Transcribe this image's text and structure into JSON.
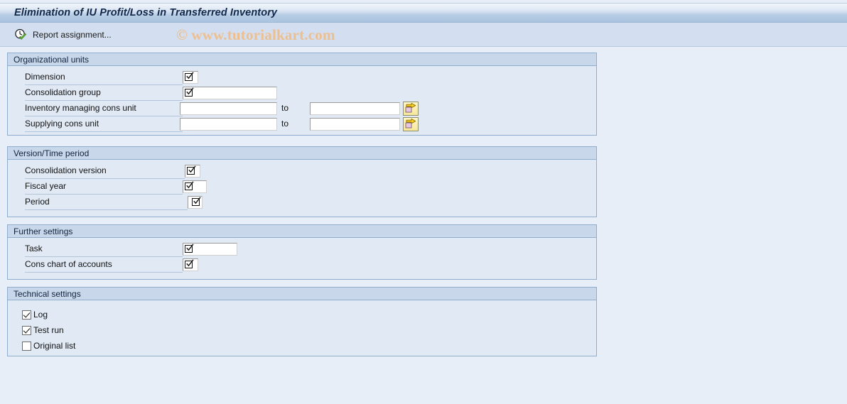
{
  "window": {
    "title": "Elimination of IU Profit/Loss in Transferred Inventory"
  },
  "toolbar": {
    "report_assignment_label": "Report assignment...",
    "report_assignment_icon": "clock-check-icon"
  },
  "watermark": {
    "text": "© www.tutorialkart.com",
    "color": "#edbf8f"
  },
  "colors": {
    "page_background": "#e8eef7",
    "group_background": "#e0e9f4",
    "group_header": "#c8d8ea",
    "group_border": "#8fadcd",
    "titlebar_text": "#11284a",
    "msel_button": "#f6e89a"
  },
  "groups": [
    {
      "title": "Organizational units",
      "fields": [
        {
          "label": "Dimension",
          "value": "",
          "type": "input-glyph"
        },
        {
          "label": "Consolidation group",
          "value": "",
          "type": "input-glyph"
        },
        {
          "label": "Inventory managing cons unit",
          "value": "",
          "to_label": "to",
          "to_value": "",
          "type": "range",
          "msel_icon": "yellow-arrow-icon"
        },
        {
          "label": "Supplying cons unit",
          "value": "",
          "to_label": "to",
          "to_value": "",
          "type": "range",
          "msel_icon": "yellow-arrow-icon"
        }
      ]
    },
    {
      "title": "Version/Time period",
      "fields": [
        {
          "label": "Consolidation version",
          "value": "",
          "type": "input-glyph"
        },
        {
          "label": "Fiscal year",
          "value": "",
          "type": "input-glyph"
        },
        {
          "label": "Period",
          "value": "",
          "type": "input-glyph"
        }
      ]
    },
    {
      "title": "Further settings",
      "fields": [
        {
          "label": "Task",
          "value": "",
          "type": "input-glyph"
        },
        {
          "label": "Cons chart of accounts",
          "value": "",
          "type": "input-glyph"
        }
      ]
    },
    {
      "title": "Technical settings",
      "checkboxes": [
        {
          "label": "Log",
          "checked": true
        },
        {
          "label": "Test run",
          "checked": true
        },
        {
          "label": "Original list",
          "checked": false
        }
      ]
    }
  ]
}
